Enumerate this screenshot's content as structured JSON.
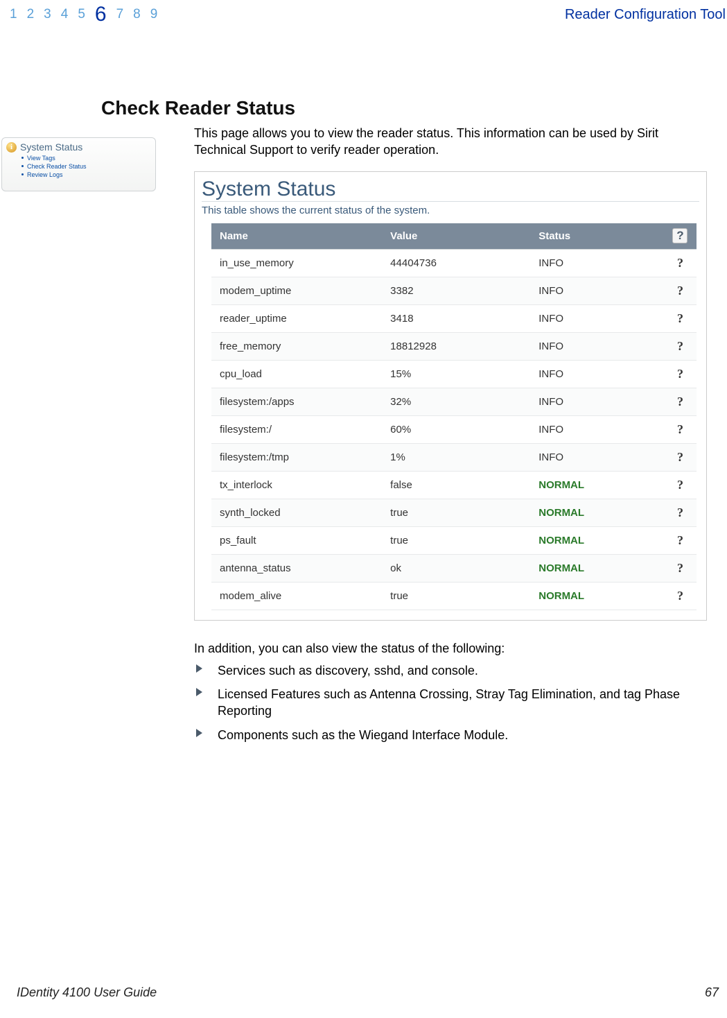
{
  "header": {
    "chapters": [
      "1",
      "2",
      "3",
      "4",
      "5",
      "6",
      "7",
      "8",
      "9"
    ],
    "active_index": 5,
    "tool_title": "Reader Configuration Tool"
  },
  "section": {
    "heading": "Check Reader Status",
    "intro": "This page allows you to view the reader status. This information can be used by Sirit Technical Support to verify reader operation."
  },
  "nav_box": {
    "title": "System Status",
    "items": [
      "View Tags",
      "Check Reader Status",
      "Review Logs"
    ]
  },
  "panel": {
    "title": "System Status",
    "subtitle": "This table shows the current status of the system.",
    "columns": {
      "name": "Name",
      "value": "Value",
      "status": "Status"
    },
    "help_header_glyph": "?",
    "rows": [
      {
        "name": "in_use_memory",
        "value": "44404736",
        "status": "INFO",
        "status_kind": "info"
      },
      {
        "name": "modem_uptime",
        "value": "3382",
        "status": "INFO",
        "status_kind": "info"
      },
      {
        "name": "reader_uptime",
        "value": "3418",
        "status": "INFO",
        "status_kind": "info"
      },
      {
        "name": "free_memory",
        "value": "18812928",
        "status": "INFO",
        "status_kind": "info"
      },
      {
        "name": "cpu_load",
        "value": "15%",
        "status": "INFO",
        "status_kind": "info"
      },
      {
        "name": "filesystem:/apps",
        "value": "32%",
        "status": "INFO",
        "status_kind": "info"
      },
      {
        "name": "filesystem:/",
        "value": "60%",
        "status": "INFO",
        "status_kind": "info"
      },
      {
        "name": "filesystem:/tmp",
        "value": "1%",
        "status": "INFO",
        "status_kind": "info"
      },
      {
        "name": "tx_interlock",
        "value": "false",
        "status": "NORMAL",
        "status_kind": "normal"
      },
      {
        "name": "synth_locked",
        "value": "true",
        "status": "NORMAL",
        "status_kind": "normal"
      },
      {
        "name": "ps_fault",
        "value": "true",
        "status": "NORMAL",
        "status_kind": "normal"
      },
      {
        "name": "antenna_status",
        "value": "ok",
        "status": "NORMAL",
        "status_kind": "normal"
      },
      {
        "name": "modem_alive",
        "value": "true",
        "status": "NORMAL",
        "status_kind": "normal"
      }
    ],
    "row_help_glyph": "?"
  },
  "after": {
    "lead": "In addition, you can also view the status of the following:",
    "bullets": [
      "Services such as discovery, sshd, and console.",
      "Licensed Features such as Antenna Crossing, Stray Tag Elimination, and tag Phase Reporting",
      "Components such as the Wiegand Interface Module."
    ]
  },
  "footer": {
    "left": "IDentity 4100 User Guide",
    "right": "67"
  }
}
